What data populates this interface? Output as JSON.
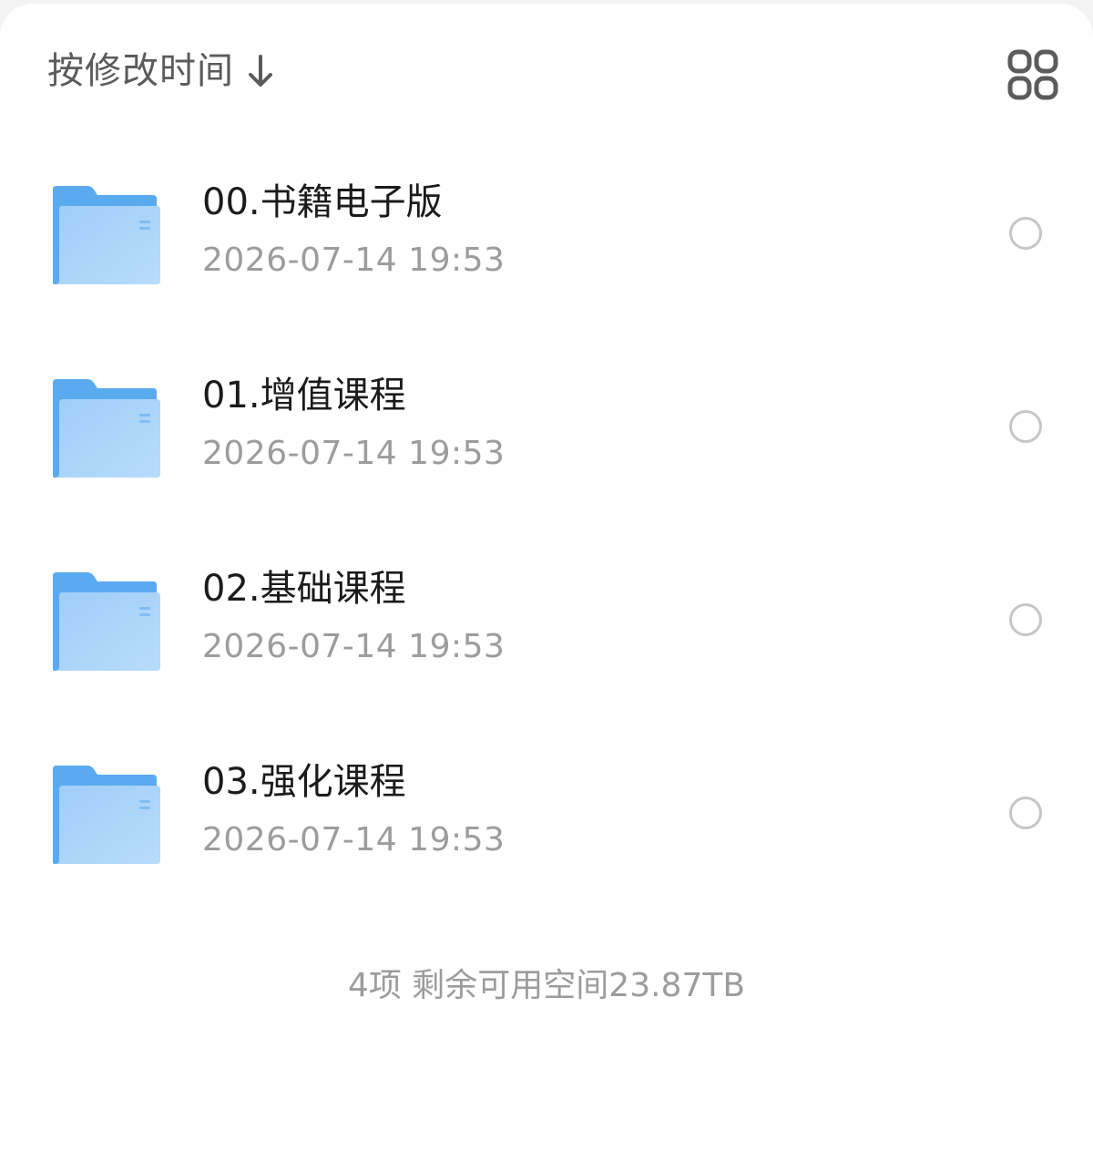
{
  "toolbar": {
    "sort_label": "按修改时间",
    "sort_icon": "arrow-down-icon",
    "view_icon": "grid-view-icon"
  },
  "colors": {
    "folder_tab": "#5aaaf0",
    "folder_front": "#a9d3fa",
    "text_primary": "#1b1b1b",
    "text_secondary": "#9c9c9c",
    "radio_border": "#c6c6c6"
  },
  "files": [
    {
      "name": "00.书籍电子版",
      "modified": "2026-07-14 19:53",
      "icon": "folder-icon"
    },
    {
      "name": "01.增值课程",
      "modified": "2026-07-14 19:53",
      "icon": "folder-icon"
    },
    {
      "name": "02.基础课程",
      "modified": "2026-07-14 19:53",
      "icon": "folder-icon"
    },
    {
      "name": "03.强化课程",
      "modified": "2026-07-14 19:53",
      "icon": "folder-icon"
    }
  ],
  "footer": {
    "summary": "4项 剩余可用空间23.87TB"
  }
}
